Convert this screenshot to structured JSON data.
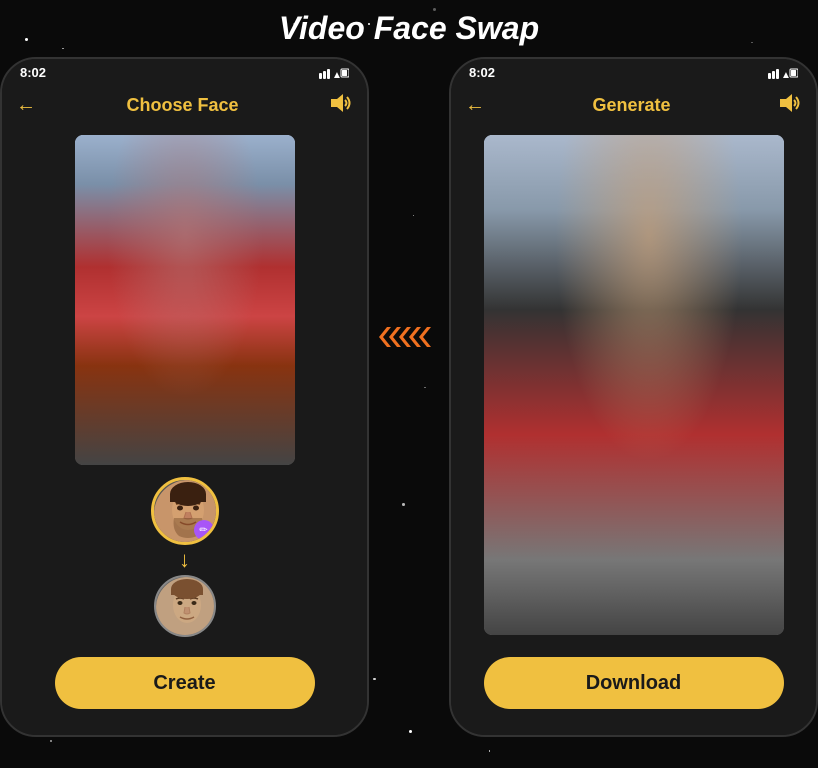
{
  "page": {
    "title": "Video Face Swap",
    "background_color": "#0a0a0a"
  },
  "phone_left": {
    "status": {
      "time": "8:02",
      "signal": "▼▲",
      "battery": "🔋"
    },
    "nav": {
      "back": "←",
      "title": "Choose Face",
      "sound": "🔊"
    },
    "create_button": "Create"
  },
  "phone_right": {
    "status": {
      "time": "8:02",
      "signal": "▼▲",
      "battery": "🔋"
    },
    "nav": {
      "back": "←",
      "title": "Generate",
      "sound": "🔊"
    },
    "download_button": "Download"
  },
  "middle_arrows": "❯❯❯❯"
}
